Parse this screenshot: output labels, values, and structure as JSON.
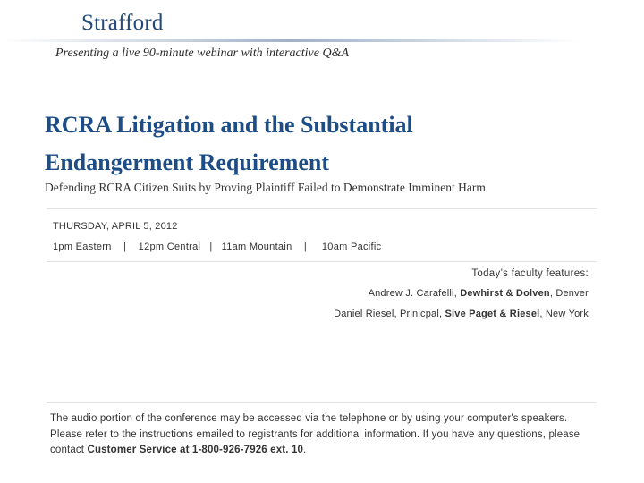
{
  "header": {
    "logo_text": "Strafford",
    "tagline": "Presenting a live 90-minute webinar with interactive Q&A"
  },
  "title": {
    "line1": "RCRA Litigation and the Substantial",
    "line2": "Endangerment Requirement",
    "subtitle": "Defending RCRA Citizen Suits by Proving Plaintiff Failed to Demonstrate Imminent Harm"
  },
  "schedule": {
    "date": "THURSDAY, APRIL 5, 2012",
    "times": "1pm Eastern    |    12pm Central   |   11am Mountain    |     10am Pacific"
  },
  "faculty": {
    "heading": "Today’s faculty features:",
    "members": [
      {
        "name": "Andrew J. Carafelli, ",
        "firm": "Dewhirst & Dolven",
        "city": ", Denver"
      },
      {
        "name": "Daniel Riesel, Prinicpal, ",
        "firm": "Sive Paget & Riesel",
        "city": ", New York"
      }
    ]
  },
  "footer": {
    "text": "The audio portion of the conference may be accessed via the telephone or by using your computer's speakers. Please refer to the instructions emailed to registrants for additional information.  If you have any questions, please contact ",
    "contact": "Customer Service at 1-800-926-7926 ext. 10",
    "end": "."
  },
  "colors": {
    "title": "#1d4d86",
    "logo": "#1f4a7c"
  }
}
